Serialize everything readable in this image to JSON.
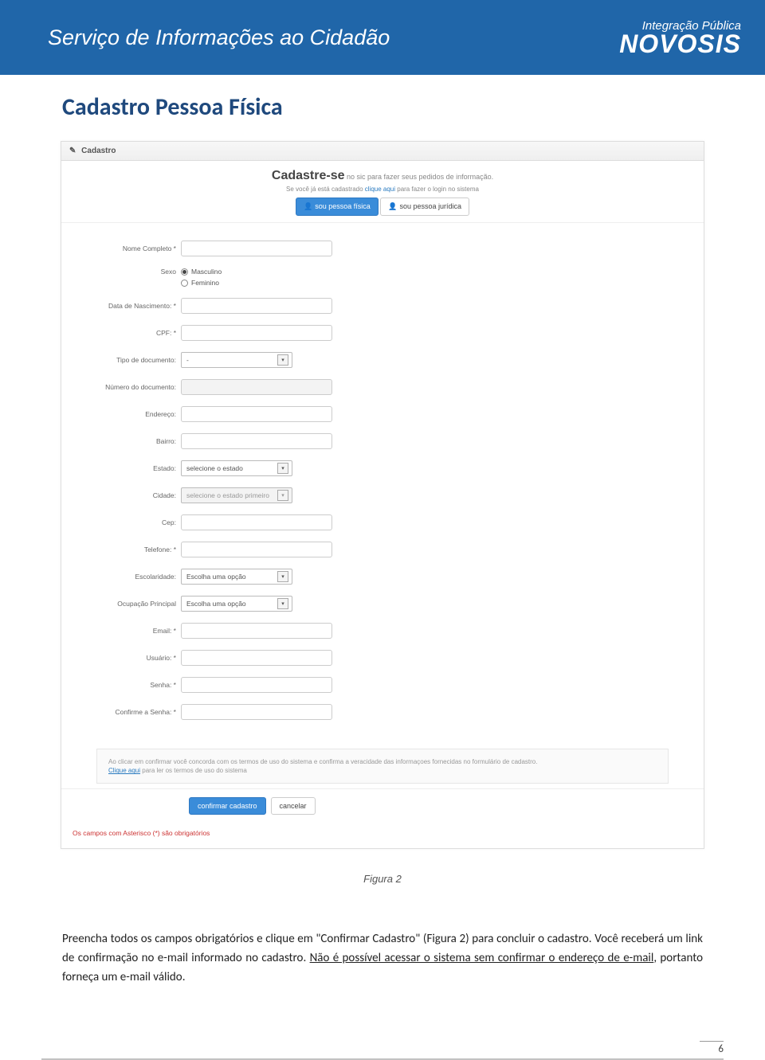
{
  "banner": {
    "title": "Serviço de Informações ao Cidadão",
    "topSmall": "Integração Pública",
    "brand": "NOVOSIS"
  },
  "page": {
    "heading": "Cadastro Pessoa Física",
    "caption": "Figura 2",
    "body1": "Preencha todos os campos obrigatórios e clique em \"Confirmar Cadastro\" (Figura 2) para concluir o cadastro. Você receberá um link de confirmação no e-mail informado no cadastro. ",
    "body2_underline": "Não é possível acessar o sistema sem confirmar o endereço de e-mail",
    "body3": ", portanto forneça um e-mail válido.",
    "pageNumber": "6"
  },
  "shot": {
    "panelTitle": "Cadastro",
    "icons": {
      "pencil": "✎",
      "person": "👤",
      "chevron": "▾"
    },
    "headlineMain": "Cadastre-se",
    "headlineSub": " no sic para fazer seus pedidos de informação.",
    "sub2_a": "Se você já está cadastrado ",
    "sub2_link": "clique aqui",
    "sub2_b": " para fazer o login no sistema",
    "btnFisica": "sou pessoa física",
    "btnJuridica": "sou pessoa jurídica",
    "selects": {
      "tipoDoc": "-",
      "estado": "selecione o estado",
      "cidade": "selecione o estado primeiro",
      "opcao": "Escolha uma opção"
    },
    "fields": {
      "nome": "Nome Completo *",
      "sexo": "Sexo",
      "sexoM": "Masculino",
      "sexoF": "Feminino",
      "nascimento": "Data de Nascimento: *",
      "cpf": "CPF: *",
      "tipoDoc": "Tipo de documento:",
      "numDoc": "Número do documento:",
      "endereco": "Endereço:",
      "bairro": "Bairro:",
      "estado": "Estado:",
      "cidade": "Cidade:",
      "cep": "Cep:",
      "telefone": "Telefone: *",
      "escolaridade": "Escolaridade:",
      "ocupacao": "Ocupação Principal",
      "email": "Email: *",
      "usuario": "Usuário: *",
      "senha": "Senha: *",
      "confirma": "Confirme a Senha: *"
    },
    "terms": {
      "l1": "Ao clicar em confirmar você concorda com os termos de uso do sistema e confirma a veracidade das informaçoes fornecidas no formulário de cadastro.",
      "link": "Clique aqui",
      "l2": " para ler os termos de uso do sistema"
    },
    "actions": {
      "confirm": "confirmar cadastro",
      "cancel": "cancelar"
    },
    "footerNote": "Os campos com Asterisco (*) são obrigatórios"
  }
}
